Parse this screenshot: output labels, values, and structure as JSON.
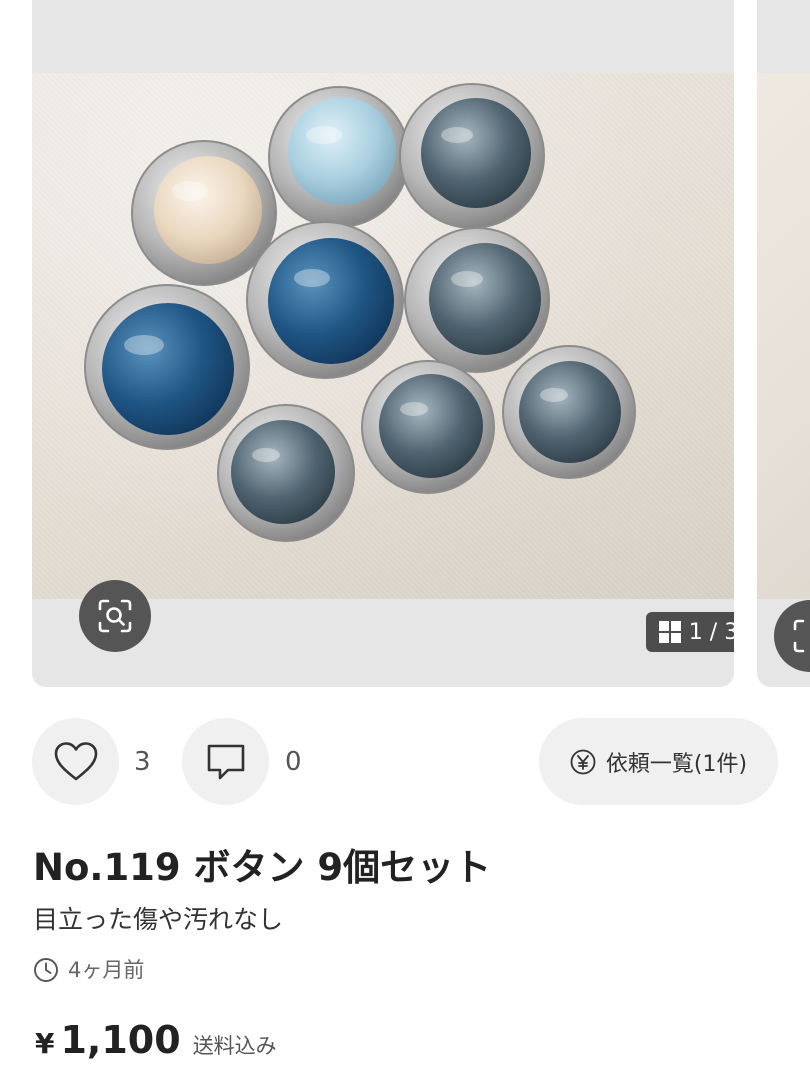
{
  "gallery": {
    "counter_text": "1 / 3",
    "image_icon": "button-photo",
    "lens_icon": "visual-search-icon",
    "grid_icon": "grid-icon"
  },
  "actions": {
    "like_count": "3",
    "comment_count": "0",
    "request_label": "依頼一覧(1件)",
    "like_icon": "heart-icon",
    "comment_icon": "comment-icon",
    "request_icon": "yen-circle-icon"
  },
  "item": {
    "title": "No.119 ボタン 9個セット",
    "subtitle": "目立った傷や汚れなし",
    "posted": "4ヶ月前",
    "currency": "¥",
    "price": "1,100",
    "shipping": "送料込み"
  },
  "colors": {
    "card_bg": "#e6e6e6",
    "button_bg": "#f0f0f0",
    "overlay_dark": "#4d4d4d",
    "text_primary": "#222222"
  }
}
